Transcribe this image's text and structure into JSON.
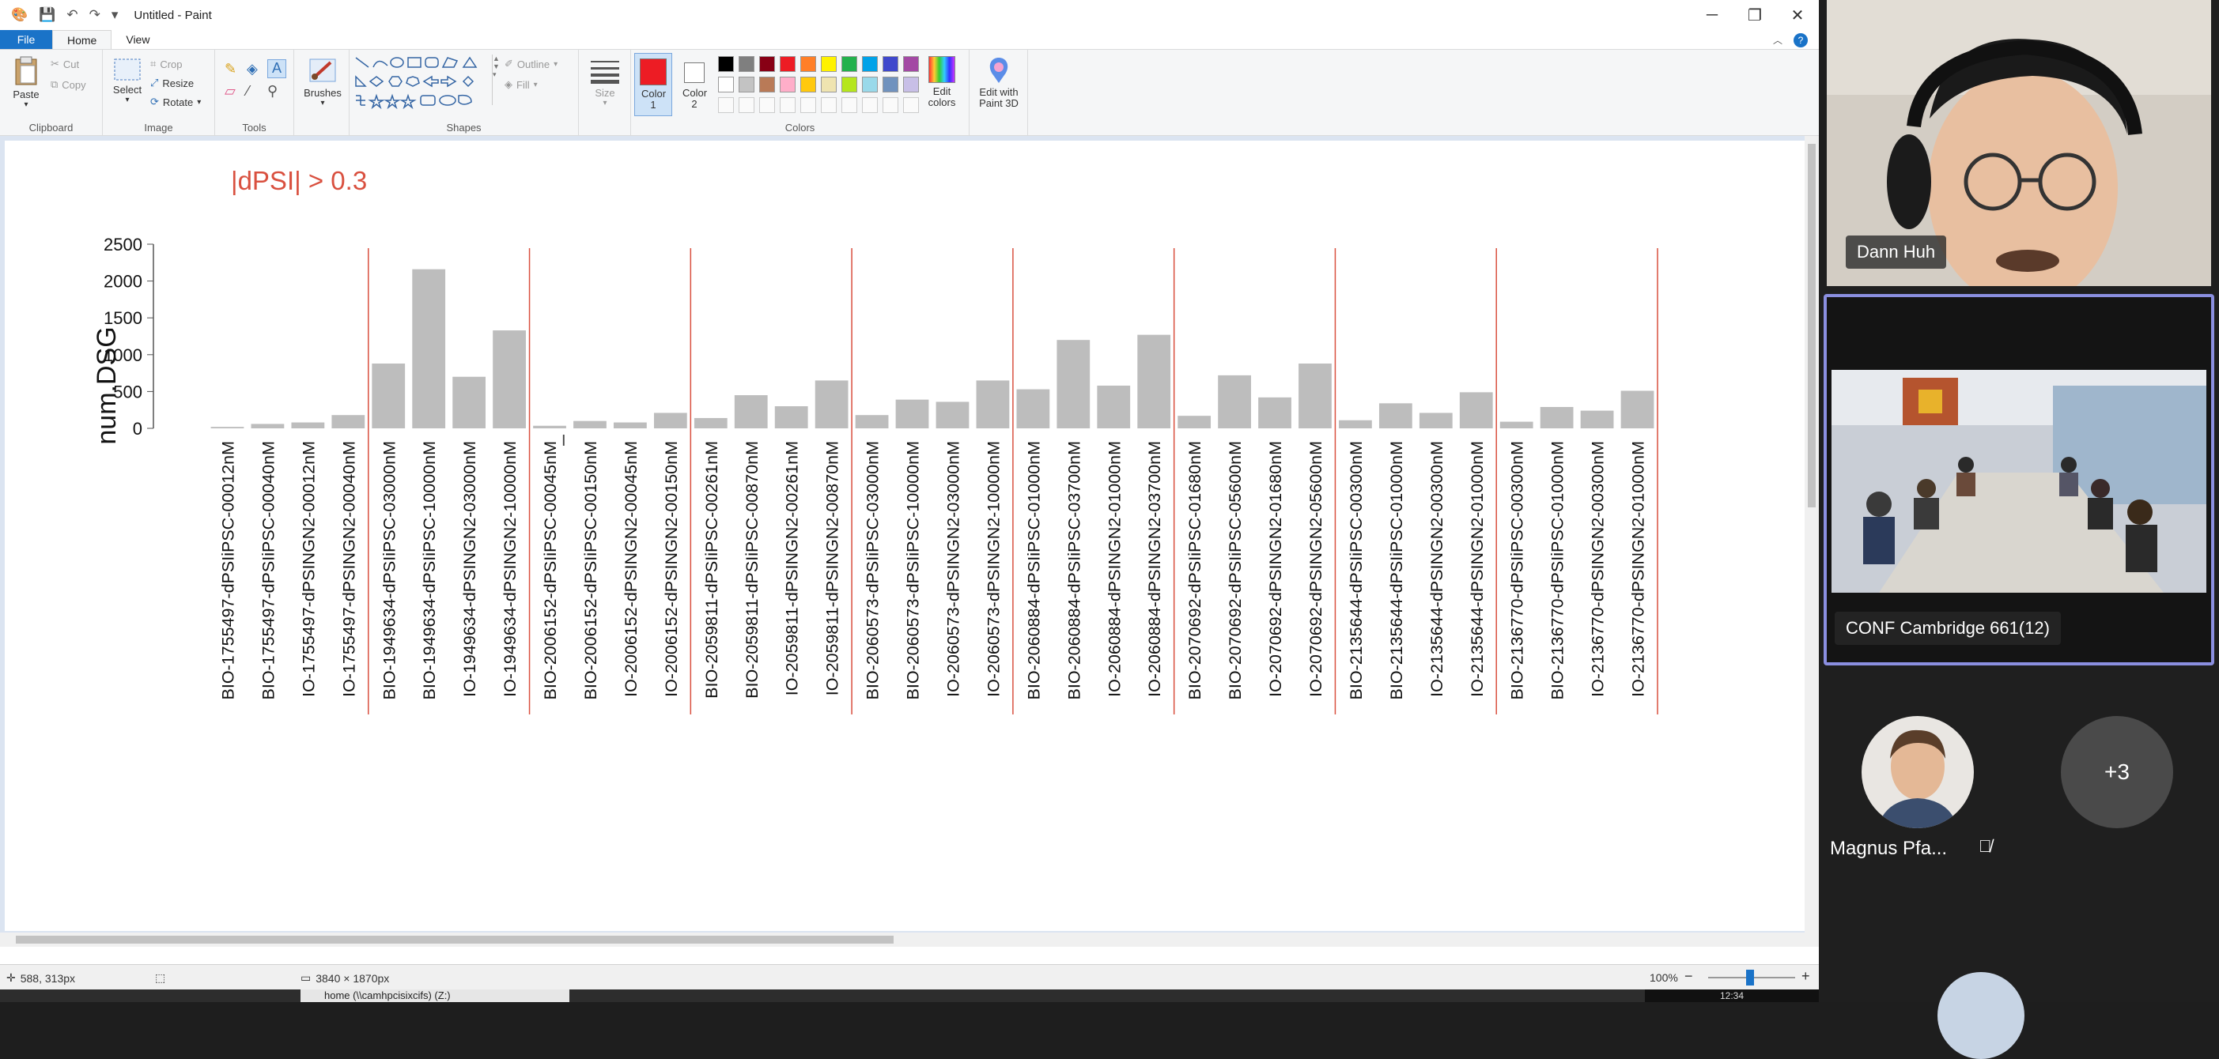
{
  "window": {
    "title": "Untitled - Paint",
    "min": "─",
    "max": "❐",
    "close": "✕"
  },
  "menu": {
    "file": "File",
    "home": "Home",
    "view": "View"
  },
  "ribbon": {
    "clipboard": {
      "label": "Clipboard",
      "paste": "Paste",
      "cut": "Cut",
      "copy": "Copy"
    },
    "image": {
      "label": "Image",
      "select": "Select",
      "crop": "Crop",
      "resize": "Resize",
      "rotate": "Rotate"
    },
    "tools": {
      "label": "Tools"
    },
    "brushes": {
      "label": "Brushes"
    },
    "shapes": {
      "label": "Shapes",
      "outline": "Outline",
      "fill": "Fill"
    },
    "size": {
      "label": "Size"
    },
    "colors": {
      "label": "Colors",
      "color1": "Color 1",
      "color2": "Color 2",
      "edit_colors": "Edit colors",
      "edit_paint3d": "Edit with Paint 3D",
      "palette_row1": [
        "#000000",
        "#7f7f7f",
        "#880015",
        "#ed1c24",
        "#ff7f27",
        "#fff200",
        "#22b14c",
        "#00a2e8",
        "#3f48cc",
        "#a349a4"
      ],
      "palette_row2": [
        "#ffffff",
        "#c3c3c3",
        "#b97a57",
        "#ffaec9",
        "#ffc90e",
        "#efe4b0",
        "#b5e61d",
        "#99d9ea",
        "#7092be",
        "#c8bfe7"
      ],
      "color1_value": "#ed1c24",
      "color2_value": "#ffffff"
    }
  },
  "canvas": {
    "annotation": "|dPSI| > 0.3",
    "annotation_color": "#d9503f"
  },
  "chart_data": {
    "type": "bar",
    "ylabel": "num.DSG",
    "ylim": [
      0,
      2500
    ],
    "yticks": [
      "0",
      "500",
      "1000",
      "1500",
      "2000",
      "2500"
    ],
    "ytick_labels_visible": [
      "0",
      "500",
      "1000",
      "1500",
      "2000",
      "2500"
    ],
    "bar_color": "#bdbdbd",
    "separator_color": "#d9503f",
    "separators_after_index": [
      3,
      7,
      11,
      15,
      19,
      23,
      27,
      31,
      35
    ],
    "categories": [
      "BIO-1755497-dPSIiPSC-00012nM",
      "BIO-1755497-dPSIiPSC-00040nM",
      "IO-1755497-dPSINGN2-00012nM",
      "IO-1755497-dPSINGN2-00040nM",
      "BIO-1949634-dPSIiPSC-03000nM",
      "BIO-1949634-dPSIiPSC-10000nM",
      "IO-1949634-dPSINGN2-03000nM",
      "IO-1949634-dPSINGN2-10000nM",
      "BIO-2006152-dPSIiPSC-00045nM",
      "BIO-2006152-dPSIiPSC-00150nM",
      "IO-2006152-dPSINGN2-00045nM",
      "IO-2006152-dPSINGN2-00150nM",
      "BIO-2059811-dPSIiPSC-00261nM",
      "BIO-2059811-dPSIiPSC-00870nM",
      "IO-2059811-dPSINGN2-00261nM",
      "IO-2059811-dPSINGN2-00870nM",
      "BIO-2060573-dPSIiPSC-03000nM",
      "BIO-2060573-dPSIiPSC-10000nM",
      "IO-2060573-dPSINGN2-03000nM",
      "IO-2060573-dPSINGN2-10000nM",
      "BIO-2060884-dPSIiPSC-01000nM",
      "BIO-2060884-dPSIiPSC-03700nM",
      "IO-2060884-dPSINGN2-01000nM",
      "IO-2060884-dPSINGN2-03700nM",
      "BIO-2070692-dPSIiPSC-01680nM",
      "BIO-2070692-dPSIiPSC-05600nM",
      "IO-2070692-dPSINGN2-01680nM",
      "IO-2070692-dPSINGN2-05600nM",
      "BIO-2135644-dPSIiPSC-00300nM",
      "BIO-2135644-dPSIiPSC-01000nM",
      "IO-2135644-dPSINGN2-00300nM",
      "IO-2135644-dPSINGN2-01000nM",
      "BIO-2136770-dPSIiPSC-00300nM",
      "BIO-2136770-dPSIiPSC-01000nM",
      "IO-2136770-dPSINGN2-00300nM",
      "IO-2136770-dPSINGN2-01000nM"
    ],
    "values": [
      20,
      60,
      80,
      180,
      880,
      2160,
      700,
      1330,
      35,
      100,
      80,
      210,
      140,
      450,
      300,
      650,
      180,
      390,
      360,
      650,
      530,
      1200,
      580,
      1270,
      170,
      720,
      420,
      880,
      110,
      340,
      210,
      490,
      90,
      290,
      240,
      510
    ]
  },
  "statusbar": {
    "cursor": "588, 313px",
    "dimensions": "3840 × 1870px",
    "zoom": "100%",
    "zoom_out": "−",
    "zoom_in": "+"
  },
  "taskbar": {
    "item": "home (\\\\camhpcisixcifs) (Z:)",
    "clock": "12:34"
  },
  "video": {
    "participant1": "Dann Huh",
    "room": "CONF Cambridge 661(12)",
    "participant3": "Magnus Pfa...",
    "more": "+3"
  }
}
